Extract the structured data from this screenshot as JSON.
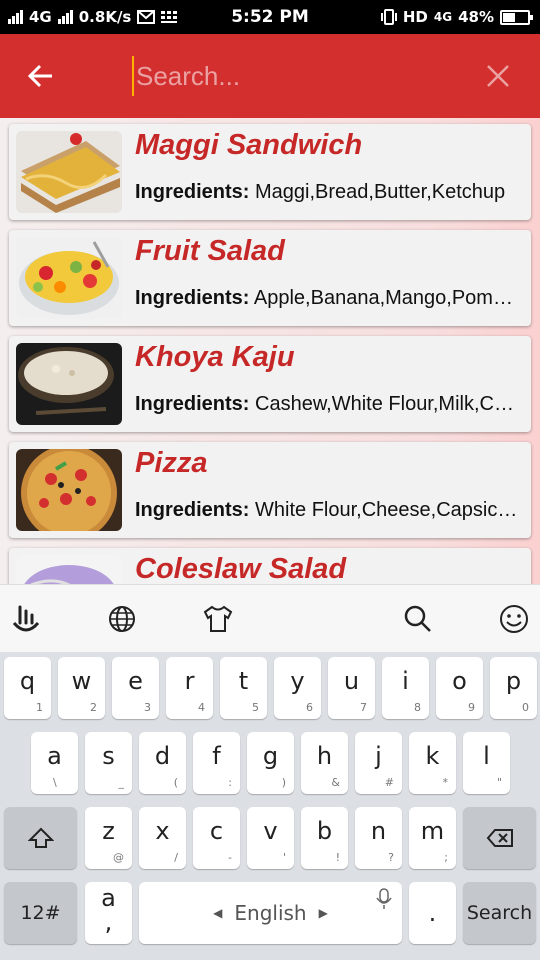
{
  "status_bar": {
    "left_net": "4G",
    "speed": "0.8K/s",
    "time": "5:52 PM",
    "hd": "HD",
    "net2": "4G",
    "battery": "48%",
    "battery_level": 0.48
  },
  "toolbar": {
    "search_placeholder": "Search...",
    "back_icon": "arrow-left-icon",
    "clear_icon": "close-icon"
  },
  "recipes": [
    {
      "name": "Maggi Sandwich",
      "ingredients_label": "Ingredients:",
      "ingredients": "Maggi,Bread,Butter,Ketchup"
    },
    {
      "name": "Fruit Salad",
      "ingredients_label": "Ingredients:",
      "ingredients": "Apple,Banana,Mango,Pomegranate"
    },
    {
      "name": "Khoya Kaju",
      "ingredients_label": "Ingredients:",
      "ingredients": "Cashew,White Flour,Milk,Curd"
    },
    {
      "name": "Pizza",
      "ingredients_label": "Ingredients:",
      "ingredients": "White Flour,Cheese,Capsicum"
    },
    {
      "name": "Coleslaw Salad",
      "ingredients_label": "",
      "ingredients": ""
    }
  ],
  "keyboard": {
    "row1": [
      {
        "main": "q",
        "sub": "1"
      },
      {
        "main": "w",
        "sub": "2"
      },
      {
        "main": "e",
        "sub": "3"
      },
      {
        "main": "r",
        "sub": "4"
      },
      {
        "main": "t",
        "sub": "5"
      },
      {
        "main": "y",
        "sub": "6"
      },
      {
        "main": "u",
        "sub": "7"
      },
      {
        "main": "i",
        "sub": "8"
      },
      {
        "main": "o",
        "sub": "9"
      },
      {
        "main": "p",
        "sub": "0"
      }
    ],
    "row2": [
      {
        "main": "a",
        "sub": "\\"
      },
      {
        "main": "s",
        "sub": "_"
      },
      {
        "main": "d",
        "sub": "("
      },
      {
        "main": "f",
        "sub": ":"
      },
      {
        "main": "g",
        "sub": ")"
      },
      {
        "main": "h",
        "sub": "&"
      },
      {
        "main": "j",
        "sub": "#"
      },
      {
        "main": "k",
        "sub": "*"
      },
      {
        "main": "l",
        "sub": "\""
      }
    ],
    "row3": [
      {
        "main": "z",
        "sub": "@"
      },
      {
        "main": "x",
        "sub": "/"
      },
      {
        "main": "c",
        "sub": "-"
      },
      {
        "main": "v",
        "sub": "'"
      },
      {
        "main": "b",
        "sub": "!"
      },
      {
        "main": "n",
        "sub": "?"
      },
      {
        "main": "m",
        "sub": ";"
      }
    ],
    "numbers_key": "12#",
    "emoji_key_main": "a",
    "emoji_key_sub": ",",
    "space_label": "English",
    "period": ".",
    "action_label": "Search"
  }
}
